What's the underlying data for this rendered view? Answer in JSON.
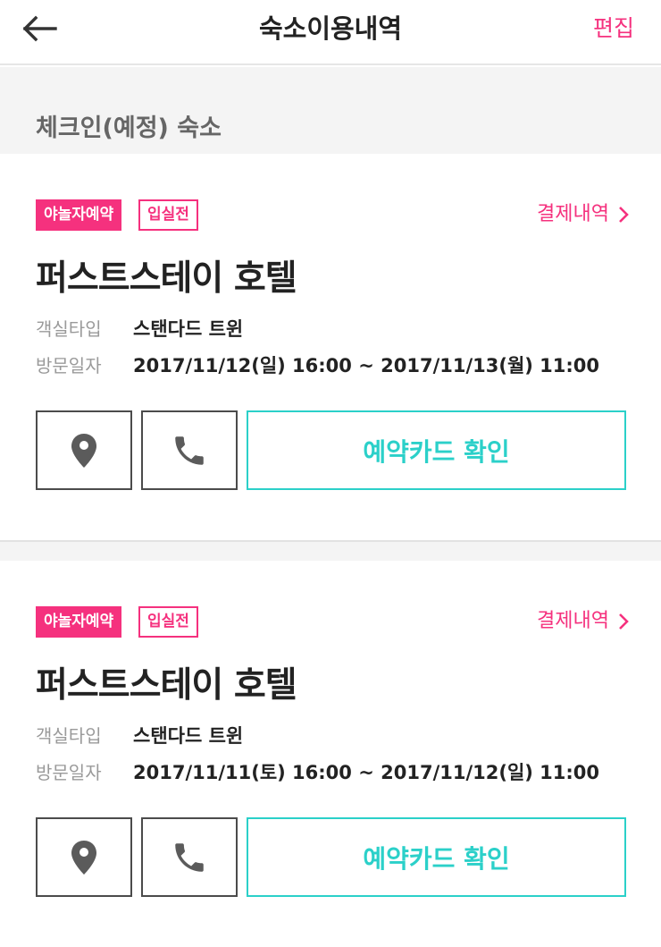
{
  "header": {
    "title": "숙소이용내역",
    "edit_label": "편집",
    "back_icon": "arrow-left-icon"
  },
  "section": {
    "title": "체크인(예정) 숙소"
  },
  "colors": {
    "accent": "#f5317e",
    "teal": "#2bd0c9",
    "icon": "#5b5b5b"
  },
  "reservations": [
    {
      "badge_primary": "야놀자예약",
      "badge_status": "입실전",
      "payment_link": "결제내역",
      "hotel_name": "퍼스트스테이 호텔",
      "room_type_label": "객실타입",
      "room_type_value": "스탠다드 트윈",
      "visit_date_label": "방문일자",
      "visit_date_value": "2017/11/12(일) 16:00 ~ 2017/11/13(월) 11:00",
      "map_icon": "location-pin-icon",
      "call_icon": "phone-icon",
      "card_button_label": "예약카드 확인"
    },
    {
      "badge_primary": "야놀자예약",
      "badge_status": "입실전",
      "payment_link": "결제내역",
      "hotel_name": "퍼스트스테이 호텔",
      "room_type_label": "객실타입",
      "room_type_value": "스탠다드 트윈",
      "visit_date_label": "방문일자",
      "visit_date_value": "2017/11/11(토) 16:00 ~ 2017/11/12(일) 11:00",
      "map_icon": "location-pin-icon",
      "call_icon": "phone-icon",
      "card_button_label": "예약카드 확인"
    }
  ]
}
